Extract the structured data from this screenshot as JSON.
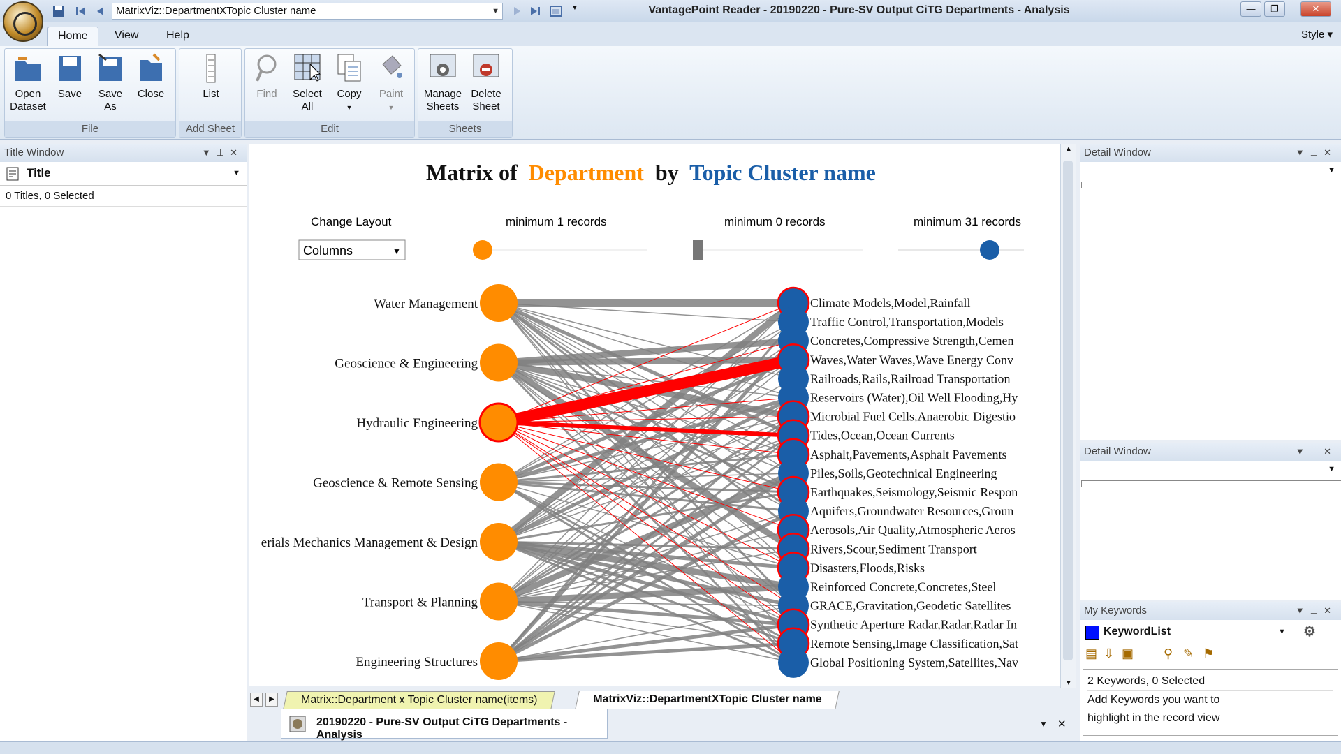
{
  "window": {
    "quick_access_combo": "MatrixViz::DepartmentXTopic Cluster name",
    "title": "VantagePoint Reader - 20190220 - Pure-SV Output CiTG Departments - Analysis"
  },
  "menu": {
    "tabs": [
      "Home",
      "View",
      "Help"
    ],
    "style": "Style"
  },
  "ribbon": {
    "groups": {
      "file": {
        "label": "File",
        "buttons": [
          "Open\nDataset",
          "Save",
          "Save\nAs",
          "Close"
        ]
      },
      "add_sheet": {
        "label": "Add Sheet",
        "buttons": [
          "List"
        ]
      },
      "edit": {
        "label": "Edit",
        "buttons": [
          "Find",
          "Select\nAll",
          "Copy",
          "Paint"
        ]
      },
      "sheets": {
        "label": "Sheets",
        "buttons": [
          "Manage\nSheets",
          "Delete\nSheet"
        ]
      }
    }
  },
  "title_window": {
    "header": "Title Window",
    "field": "Title",
    "status": "0 Titles, 0 Selected"
  },
  "detail_windows": [
    {
      "header": "Detail Window"
    },
    {
      "header": "Detail Window"
    }
  ],
  "my_keywords": {
    "header": "My Keywords",
    "list_name": "KeywordList",
    "status": "2 Keywords, 0 Selected",
    "hint_line1": "Add Keywords you want to",
    "hint_line2": "highlight in the record view"
  },
  "viz": {
    "title_prefix": "Matrix of",
    "title_field1": "Department",
    "title_mid": "by",
    "title_field2": "Topic Cluster name",
    "color_field1": "#ff8c00",
    "color_field2": "#1a5ea8",
    "change_layout_label": "Change Layout",
    "layout_value": "Columns",
    "min_left_label": "minimum 1 records",
    "min_mid_label": "minimum 0 records",
    "min_right_label": "minimum 31 records",
    "departments": [
      "Water Management",
      "Geoscience & Engineering",
      "Hydraulic Engineering",
      "Geoscience & Remote Sensing",
      "erials Mechanics Management & Design",
      "Transport & Planning",
      "Engineering Structures"
    ],
    "topics": [
      "Climate Models,Model,Rainfall",
      "Traffic Control,Transportation,Models",
      "Concretes,Compressive Strength,Cemen",
      "Waves,Water Waves,Wave Energy Conv",
      "Railroads,Rails,Railroad Transportation",
      "Reservoirs (Water),Oil Well Flooding,Hy",
      "Microbial Fuel Cells,Anaerobic Digestio",
      "Tides,Ocean,Ocean Currents",
      "Asphalt,Pavements,Asphalt Pavements",
      "Piles,Soils,Geotechnical Engineering",
      "Earthquakes,Seismology,Seismic Respon",
      "Aquifers,Groundwater Resources,Groun",
      "Aerosols,Air Quality,Atmospheric Aeros",
      "Rivers,Scour,Sediment Transport",
      "Disasters,Floods,Risks",
      "Reinforced Concrete,Concretes,Steel",
      "GRACE,Gravitation,Geodetic Satellites",
      "Synthetic Aperture Radar,Radar,Radar In",
      "Remote Sensing,Image Classification,Sat",
      "Global Positioning System,Satellites,Nav"
    ],
    "selected_department": "Hydraulic Engineering",
    "highlight_color": "#ff0000",
    "link_color": "#808080"
  },
  "sheet_tabs": {
    "tab1": "Matrix::Department x Topic Cluster name(items)",
    "tab2": "MatrixViz::DepartmentXTopic Cluster name"
  },
  "document_tab": "20190220 - Pure-SV Output CiTG Departments - Analysis"
}
